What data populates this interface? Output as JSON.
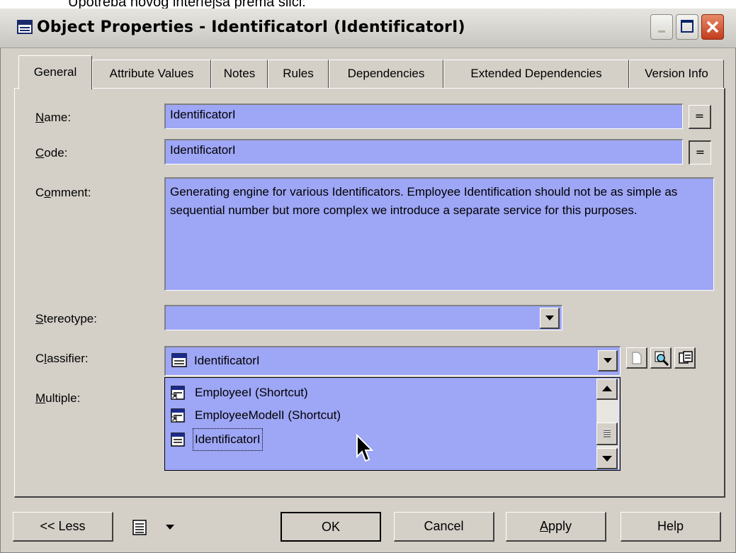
{
  "caption": "Upotreba novog interfejsa prema slici:",
  "window": {
    "title": "Object Properties - IdentificatorI (IdentificatorI)"
  },
  "tabs": [
    {
      "label": "General",
      "active": true
    },
    {
      "label": "Attribute Values"
    },
    {
      "label": "Notes"
    },
    {
      "label": "Rules"
    },
    {
      "label": "Dependencies"
    },
    {
      "label": "Extended Dependencies"
    },
    {
      "label": "Version Info"
    }
  ],
  "form": {
    "name_label_key": "N",
    "name_label_rest": "ame:",
    "name_value": "IdentificatorI",
    "code_label_key": "C",
    "code_label_rest": "ode:",
    "code_value": "IdentificatorI",
    "comment_label_pre": "C",
    "comment_label_key": "o",
    "comment_label_rest": "mment:",
    "comment_value": "Generating engine for various Identificators. Employee Identification should not be as simple as sequential number but more complex we introduce a separate service for this purposes.",
    "stereotype_label_key": "S",
    "stereotype_label_rest": "tereotype:",
    "stereotype_value": "",
    "classifier_label_pre": "C",
    "classifier_label_key": "l",
    "classifier_label_rest": "assifier:",
    "classifier_value": "IdentificatorI",
    "multiple_label_key": "M",
    "multiple_label_rest": "ultiple:",
    "equals": "="
  },
  "classifier_list": [
    {
      "label": "EmployeeI (Shortcut)",
      "icon": "shortcut-class-icon"
    },
    {
      "label": "EmployeeModelI (Shortcut)",
      "icon": "shortcut-class-icon"
    },
    {
      "label": "IdentificatorI",
      "icon": "class-icon",
      "selected": true
    }
  ],
  "buttons": {
    "less": "<< Less",
    "ok": "OK",
    "cancel": "Cancel",
    "apply_key": "A",
    "apply_rest": "pply",
    "help": "Help"
  },
  "colors": {
    "field_bg": "#9ea6f6",
    "dialog_bg": "#d4d0c8",
    "close_red": "#c23c1c"
  }
}
